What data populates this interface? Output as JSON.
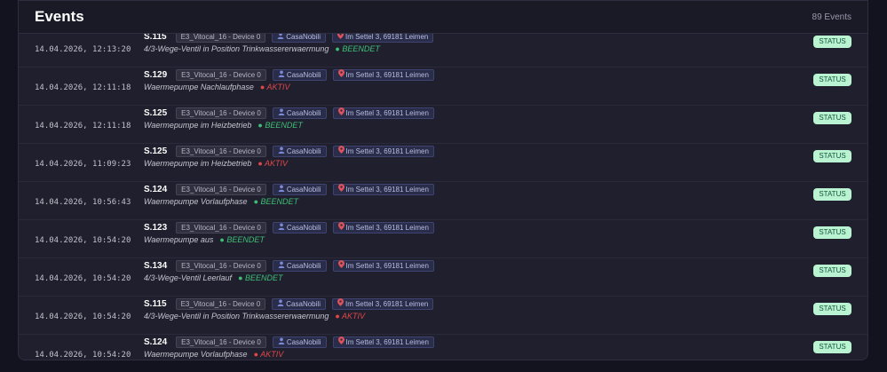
{
  "header": {
    "title": "Events",
    "count": "89 Events"
  },
  "icons": {
    "user": "user-icon",
    "location": "map-pin-icon",
    "state_dot": "dot-icon"
  },
  "colors": {
    "beendet": "#3fbf74",
    "aktiv": "#e04848",
    "status_button": "#b9f3d2"
  },
  "events": [
    {
      "timestamp": "14.04.2026, 12:13:20",
      "code": "S.115",
      "device": "E3_Vitocal_16 - Device 0",
      "user": "CasaNobili",
      "location": "Im Settel 3, 69181 Leimen",
      "description": "4/3-Wege-Ventil in Position Trinkwassererwaermung",
      "state": "BEENDET",
      "state_dot": "●",
      "action": "STATUS"
    },
    {
      "timestamp": "14.04.2026, 12:11:18",
      "code": "S.129",
      "device": "E3_Vitocal_16 - Device 0",
      "user": "CasaNobili",
      "location": "Im Settel 3, 69181 Leimen",
      "description": "Waermepumpe Nachlaufphase",
      "state": "AKTIV",
      "state_dot": "●",
      "action": "STATUS"
    },
    {
      "timestamp": "14.04.2026, 12:11:18",
      "code": "S.125",
      "device": "E3_Vitocal_16 - Device 0",
      "user": "CasaNobili",
      "location": "Im Settel 3, 69181 Leimen",
      "description": "Waermepumpe im Heizbetrieb",
      "state": "BEENDET",
      "state_dot": "●",
      "action": "STATUS"
    },
    {
      "timestamp": "14.04.2026, 11:09:23",
      "code": "S.125",
      "device": "E3_Vitocal_16 - Device 0",
      "user": "CasaNobili",
      "location": "Im Settel 3, 69181 Leimen",
      "description": "Waermepumpe im Heizbetrieb",
      "state": "AKTIV",
      "state_dot": "●",
      "action": "STATUS"
    },
    {
      "timestamp": "14.04.2026, 10:56:43",
      "code": "S.124",
      "device": "E3_Vitocal_16 - Device 0",
      "user": "CasaNobili",
      "location": "Im Settel 3, 69181 Leimen",
      "description": "Waermepumpe Vorlaufphase",
      "state": "BEENDET",
      "state_dot": "●",
      "action": "STATUS"
    },
    {
      "timestamp": "14.04.2026, 10:54:20",
      "code": "S.123",
      "device": "E3_Vitocal_16 - Device 0",
      "user": "CasaNobili",
      "location": "Im Settel 3, 69181 Leimen",
      "description": "Waermepumpe aus",
      "state": "BEENDET",
      "state_dot": "●",
      "action": "STATUS"
    },
    {
      "timestamp": "14.04.2026, 10:54:20",
      "code": "S.134",
      "device": "E3_Vitocal_16 - Device 0",
      "user": "CasaNobili",
      "location": "Im Settel 3, 69181 Leimen",
      "description": "4/3-Wege-Ventil Leerlauf",
      "state": "BEENDET",
      "state_dot": "●",
      "action": "STATUS"
    },
    {
      "timestamp": "14.04.2026, 10:54:20",
      "code": "S.115",
      "device": "E3_Vitocal_16 - Device 0",
      "user": "CasaNobili",
      "location": "Im Settel 3, 69181 Leimen",
      "description": "4/3-Wege-Ventil in Position Trinkwassererwaermung",
      "state": "AKTIV",
      "state_dot": "●",
      "action": "STATUS"
    },
    {
      "timestamp": "14.04.2026, 10:54:20",
      "code": "S.124",
      "device": "E3_Vitocal_16 - Device 0",
      "user": "CasaNobili",
      "location": "Im Settel 3, 69181 Leimen",
      "description": "Waermepumpe Vorlaufphase",
      "state": "AKTIV",
      "state_dot": "●",
      "action": "STATUS"
    }
  ]
}
